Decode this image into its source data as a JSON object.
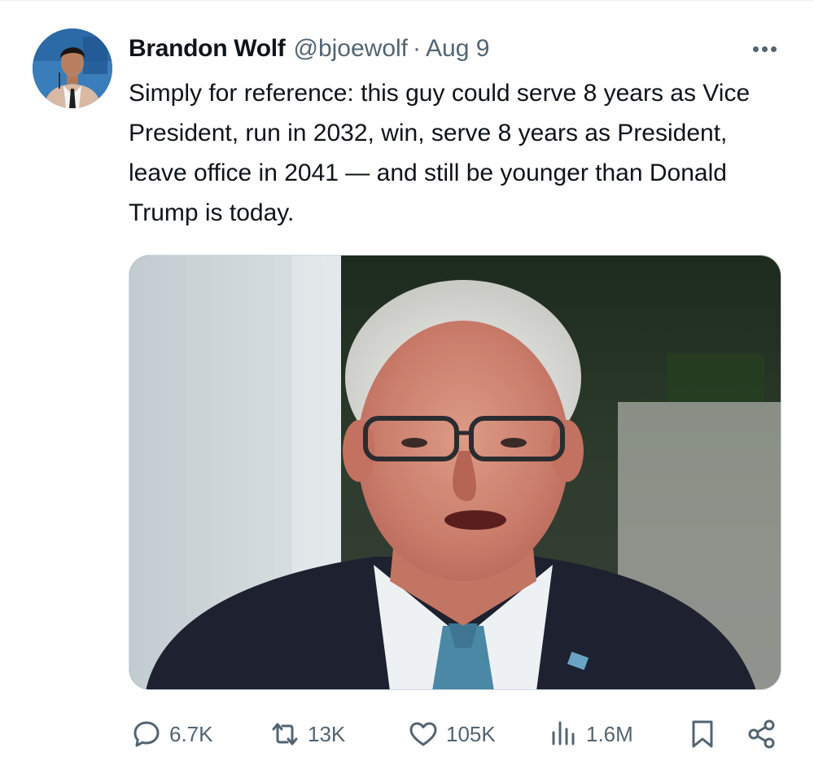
{
  "tweet": {
    "author_name": "Brandon Wolf",
    "author_handle": "@bjoewolf",
    "separator": "·",
    "date": "Aug 9",
    "text": "Simply for reference: this guy could serve 8 years as Vice President, run in 2032, win, serve 8 years as President, leave office in 2041 — and still be younger than Donald Trump is today."
  },
  "actions": {
    "replies": "6.7K",
    "reposts": "13K",
    "likes": "105K",
    "views": "1.6M"
  },
  "icons": {
    "more": "more-horizontal-icon",
    "reply": "reply-bubble-icon",
    "repost": "repost-arrows-icon",
    "like": "heart-icon",
    "views": "bar-chart-icon",
    "bookmark": "bookmark-icon",
    "share": "share-icon"
  },
  "colors": {
    "text": "#0f1419",
    "secondary": "#536471",
    "border": "#cfd9de"
  }
}
